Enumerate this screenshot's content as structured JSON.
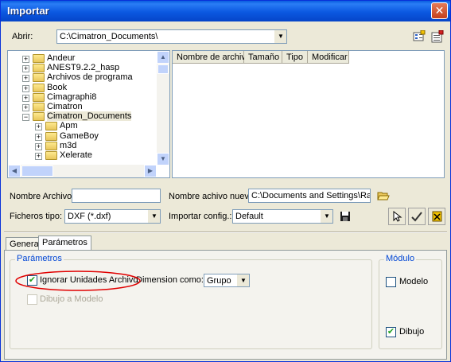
{
  "window": {
    "title": "Importar"
  },
  "abrir": {
    "label": "Abrir:",
    "value": "C:\\Cimatron_Documents\\"
  },
  "tree": {
    "items": [
      {
        "label": "Andeur",
        "level": 0,
        "expanded": false
      },
      {
        "label": "ANEST9.2.2_hasp",
        "level": 0,
        "expanded": false
      },
      {
        "label": "Archivos de programa",
        "level": 0,
        "expanded": false
      },
      {
        "label": "Book",
        "level": 0,
        "expanded": false
      },
      {
        "label": "Cimagraphi8",
        "level": 0,
        "expanded": false
      },
      {
        "label": "Cimatron",
        "level": 0,
        "expanded": false
      },
      {
        "label": "Cimatron_Documents",
        "level": 0,
        "expanded": true
      },
      {
        "label": "Apm",
        "level": 1,
        "expanded": false
      },
      {
        "label": "GameBoy",
        "level": 1,
        "expanded": false
      },
      {
        "label": "m3d",
        "level": 1,
        "expanded": false
      },
      {
        "label": "Xelerate",
        "level": 1,
        "expanded": false
      }
    ]
  },
  "filelist": {
    "columns": [
      "Nombre de archivo",
      "Tamaño",
      "Tipo",
      "Modificar"
    ]
  },
  "nombre_archivo": {
    "label": "Nombre Archivo:",
    "value": ""
  },
  "nombre_nuevo": {
    "label": "Nombre achivo nuevo:",
    "value": "C:\\Documents and Settings\\RafaEs\\M"
  },
  "ficheros_tipo": {
    "label": "Ficheros tipo:",
    "value": "DXF (*.dxf)"
  },
  "importar_config": {
    "label": "Importar config.:",
    "value": "Default"
  },
  "tabs": [
    "General",
    "Parámetros"
  ],
  "parametros": {
    "group_title": "Parámetros",
    "ignorar_label": "Ignorar Unidades Archivo",
    "ignorar_checked": true,
    "dimension_label": "Dimension como:",
    "dimension_value": "Grupo",
    "dibujo_modelo_label": "Dibujo a Modelo",
    "dibujo_modelo_checked": false
  },
  "modulo": {
    "group_title": "Módulo",
    "modelo_label": "Modelo",
    "modelo_checked": false,
    "dibujo_label": "Dibujo",
    "dibujo_checked": true
  },
  "colors": {
    "title_bar": "#0a5ddf",
    "group_title": "#0046d5",
    "highlight_ellipse": "#e00000"
  }
}
